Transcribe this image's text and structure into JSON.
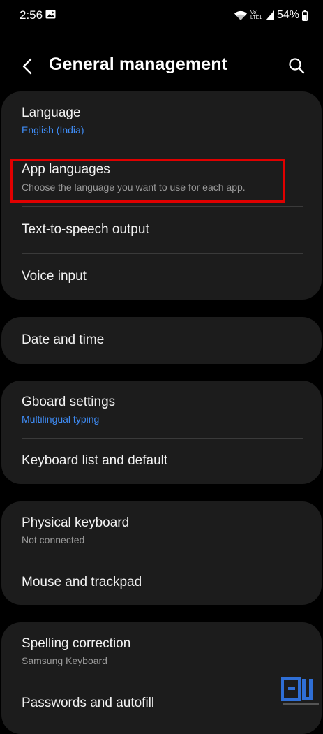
{
  "status_bar": {
    "time": "2:56",
    "volte_line1": "Vo)",
    "volte_line2": "LTE1",
    "battery": "54%"
  },
  "app_bar": {
    "title": "General management"
  },
  "groups": [
    {
      "items": [
        {
          "title": "Language",
          "subtitle": "English (India)",
          "subtitle_style": "blue"
        },
        {
          "title": "App languages",
          "subtitle": "Choose the language you want to use for each app.",
          "subtitle_style": "gray"
        },
        {
          "title": "Text-to-speech output"
        },
        {
          "title": "Voice input"
        }
      ]
    },
    {
      "items": [
        {
          "title": "Date and time"
        }
      ]
    },
    {
      "items": [
        {
          "title": "Gboard settings",
          "subtitle": "Multilingual typing",
          "subtitle_style": "blue"
        },
        {
          "title": "Keyboard list and default"
        }
      ]
    },
    {
      "items": [
        {
          "title": "Physical keyboard",
          "subtitle": "Not connected",
          "subtitle_style": "gray"
        },
        {
          "title": "Mouse and trackpad"
        }
      ]
    },
    {
      "items": [
        {
          "title": "Spelling correction",
          "subtitle": "Samsung Keyboard",
          "subtitle_style": "gray"
        },
        {
          "title": "Passwords and autofill"
        }
      ]
    }
  ],
  "colors": {
    "background": "#000000",
    "card": "#1c1c1c",
    "accent_blue": "#3f8cf5",
    "highlight_red": "#e00000",
    "subtitle_gray": "#9a9a9a"
  },
  "icons": {
    "back": "chevron-left-icon",
    "search": "search-icon"
  }
}
